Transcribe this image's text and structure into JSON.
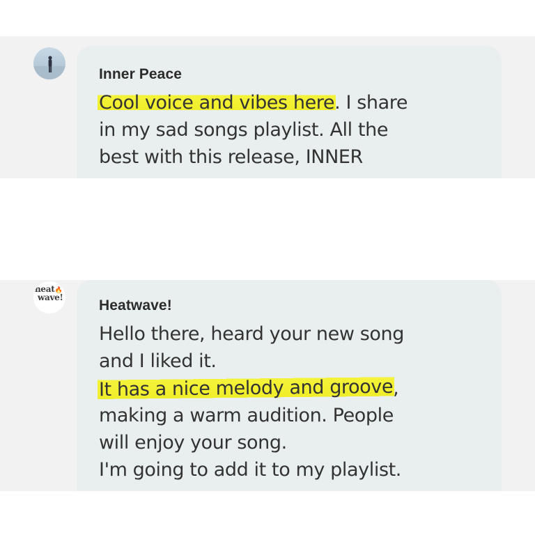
{
  "comments": [
    {
      "author": "Inner Peace",
      "avatar_icon": "person-standing-on-shore-avatar",
      "lines": [
        {
          "highlight": "Cool voice and vibes here",
          "text": ". I share"
        },
        {
          "text": "in my sad songs playlist. All the"
        },
        {
          "text": "best with this release, INNER"
        }
      ]
    },
    {
      "author": "Heatwave!",
      "avatar_logo": {
        "line1": "heat",
        "line2": "wave!",
        "flame": "🔥"
      },
      "lines": [
        {
          "text": "Hello there, heard your new song"
        },
        {
          "text": "and I liked it."
        },
        {
          "highlight": "It has a nice melody and groove",
          "text": ","
        },
        {
          "text": "making a warm audition. People"
        },
        {
          "text": "will enjoy your song."
        },
        {
          "text": "I'm going to add it to my playlist."
        }
      ]
    }
  ],
  "colors": {
    "band_bg": "#f3f2f3",
    "bubble_bg": "#e9eeee",
    "highlight": "#f0ee2a",
    "text": "#333333"
  }
}
